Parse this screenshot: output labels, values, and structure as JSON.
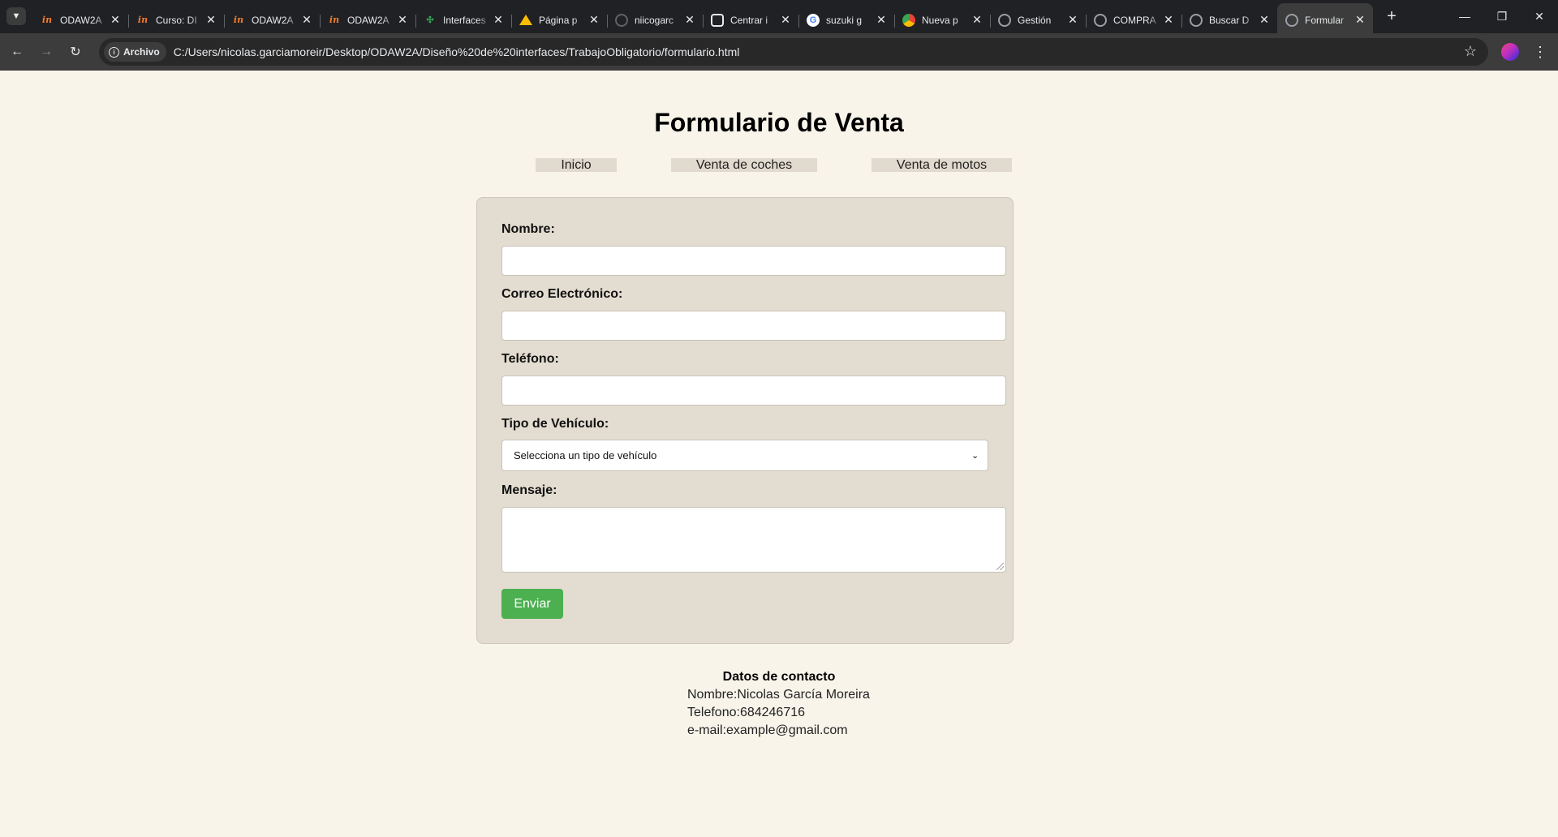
{
  "browser": {
    "tab_search_icon": "chevron-down-icon",
    "tabs": [
      {
        "title": "ODAW2A",
        "icon": "in-logo-icon"
      },
      {
        "title": "Curso: DI",
        "icon": "in-logo-icon"
      },
      {
        "title": "ODAW2A",
        "icon": "in-logo-icon"
      },
      {
        "title": "ODAW2A",
        "icon": "in-logo-icon"
      },
      {
        "title": "Interfaces",
        "icon": "pinwheel-icon"
      },
      {
        "title": "Página p",
        "icon": "drive-icon"
      },
      {
        "title": "niicogarc",
        "icon": "github-icon"
      },
      {
        "title": "Centrar i",
        "icon": "chatgpt-icon"
      },
      {
        "title": "suzuki g",
        "icon": "google-icon"
      },
      {
        "title": "Nueva p",
        "icon": "chrome-icon"
      },
      {
        "title": "Gestión",
        "icon": "globe-icon"
      },
      {
        "title": "COMPRA",
        "icon": "globe-icon"
      },
      {
        "title": "Buscar D",
        "icon": "globe-icon"
      },
      {
        "title": "Formular",
        "icon": "globe-icon",
        "active": true
      }
    ],
    "new_tab": "+",
    "window_controls": {
      "minimize": "—",
      "restore": "❐",
      "close": "✕"
    },
    "toolbar": {
      "back": "←",
      "forward": "→",
      "reload": "↻",
      "security_chip": "Archivo",
      "url": "C:/Users/nicolas.garciamoreir/Desktop/ODAW2A/Dise%C3%B1o%20de%20interfaces/TrabajoObligatorio/formulario.html",
      "url_display": "C:/Users/nicolas.garciamoreir/Desktop/ODAW2A/Diseño%20de%20interfaces/TrabajoObligatorio/formulario.html",
      "bookmark": "☆",
      "menu": "⋮"
    }
  },
  "page": {
    "title": "Formulario de Venta",
    "nav": [
      "Inicio",
      "Venta de coches",
      "Venta de motos"
    ],
    "form": {
      "name_label": "Nombre:",
      "name_value": "",
      "email_label": "Correo Electrónico:",
      "email_value": "",
      "phone_label": "Teléfono:",
      "phone_value": "",
      "vehicle_label": "Tipo de Vehículo:",
      "vehicle_selected": "Selecciona un tipo de vehículo",
      "message_label": "Mensaje:",
      "message_value": "",
      "submit_label": "Enviar"
    },
    "contact": {
      "title": "Datos de contacto",
      "name": "Nombre:Nicolas García Moreira",
      "phone": "Telefono:684246716",
      "email": "e-mail:example@gmail.com"
    }
  },
  "colors": {
    "page_background": "#f8f4ea",
    "card_background": "#e3dcd0",
    "submit_button": "#4caf50",
    "chrome_dark": "#202124"
  }
}
